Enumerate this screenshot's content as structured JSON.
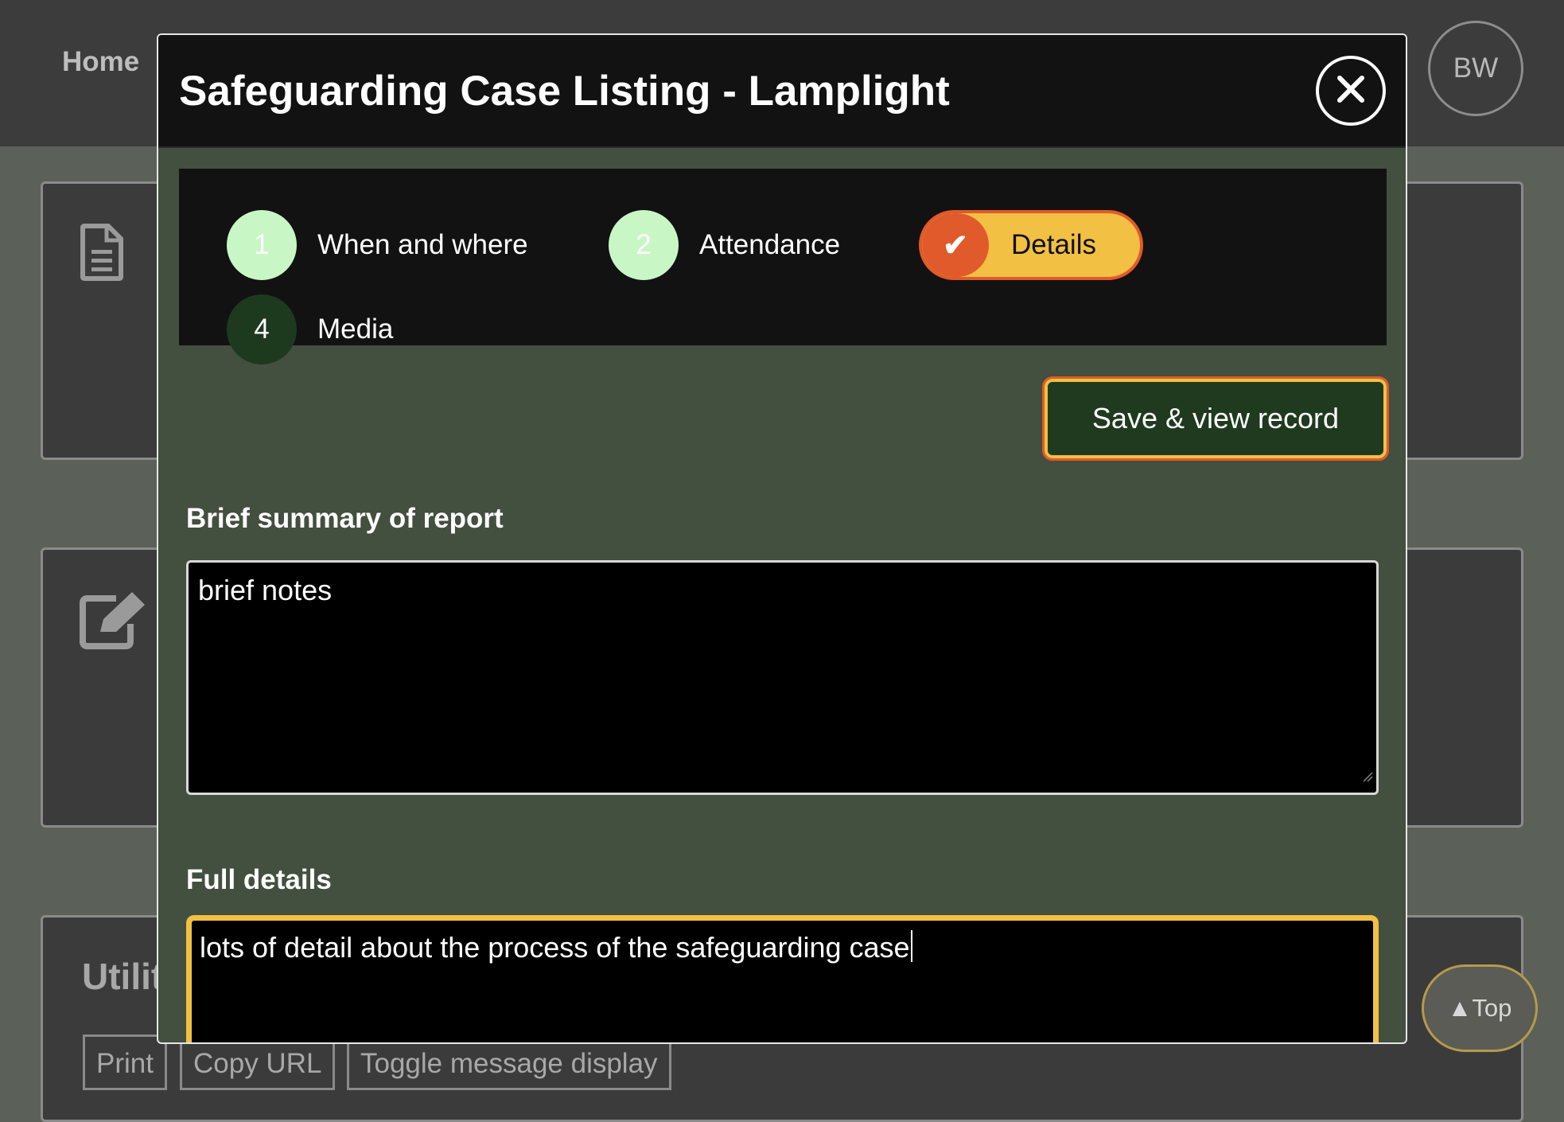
{
  "background": {
    "nav": {
      "home_label": "Home"
    },
    "user": {
      "initials": "BW"
    },
    "utilities": {
      "heading": "Utilit",
      "buttons": [
        "Print",
        "Copy URL",
        "Toggle message display"
      ]
    },
    "top_button": "▲Top"
  },
  "modal": {
    "title": "Safeguarding Case Listing - Lamplight",
    "close_icon": "close-icon",
    "steps": [
      {
        "number": "1",
        "label": "When and where",
        "state": "done"
      },
      {
        "number": "2",
        "label": "Attendance",
        "state": "done"
      },
      {
        "number": "✔",
        "label": "Details",
        "state": "active"
      },
      {
        "number": "4",
        "label": "Media",
        "state": "future"
      }
    ],
    "save_button": "Save & view record",
    "fields": {
      "summary": {
        "label": "Brief summary of report",
        "value": "brief notes"
      },
      "details": {
        "label": "Full details",
        "value": "lots of detail about the process of the safeguarding case"
      }
    }
  },
  "colors": {
    "accent_yellow": "#f2c043",
    "accent_orange": "#e05a2b",
    "step_done": "#c8f7c5",
    "step_future": "#1e3a1e",
    "modal_body": "#434f3f"
  }
}
